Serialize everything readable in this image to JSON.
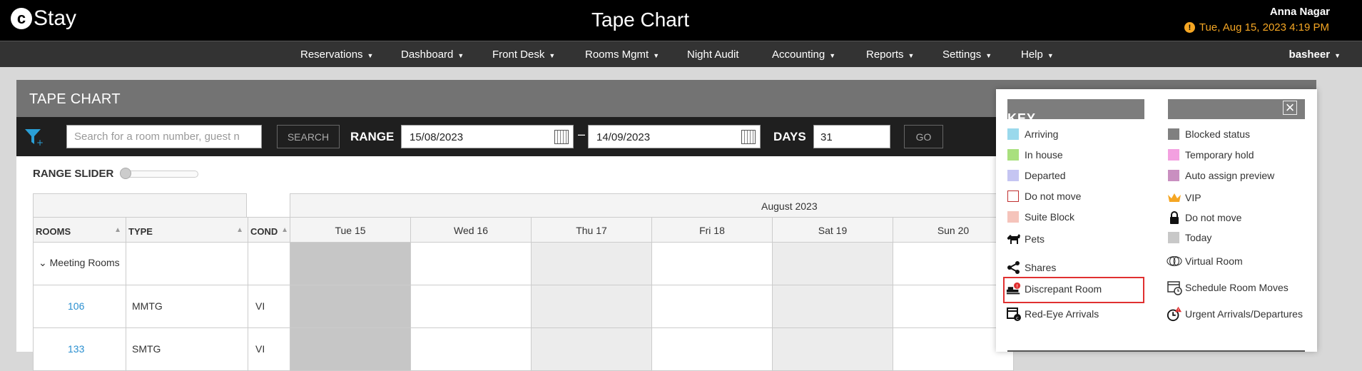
{
  "topbar": {
    "logo_letter": "c",
    "logo_text": "Stay",
    "title": "Tape Chart",
    "user_name": "Anna Nagar",
    "datetime": "Tue, Aug 15, 2023 4:19 PM"
  },
  "nav": {
    "items": [
      {
        "label": "Reservations"
      },
      {
        "label": "Dashboard"
      },
      {
        "label": "Front Desk"
      },
      {
        "label": "Rooms Mgmt"
      },
      {
        "label": "Night Audit"
      },
      {
        "label": "Accounting"
      },
      {
        "label": "Reports"
      },
      {
        "label": "Settings"
      },
      {
        "label": "Help"
      }
    ],
    "user": "basheer"
  },
  "panel": {
    "title": "TAPE CHART",
    "search_placeholder": "Search for a room number, guest n",
    "search_button": "SEARCH",
    "range_label": "RANGE",
    "range_start": "15/08/2023",
    "range_sep": "–",
    "range_end": "14/09/2023",
    "days_label": "DAYS",
    "days_value": "31",
    "go_button": "GO",
    "slider_label": "RANGE SLIDER"
  },
  "grid": {
    "month": "August 2023",
    "columns": {
      "rooms": "ROOMS",
      "type": "TYPE",
      "cond": "COND"
    },
    "days": [
      "Tue 15",
      "Wed 16",
      "Thu 17",
      "Fri 18",
      "Sat 19",
      "Sun 20"
    ],
    "group": "Meeting Rooms",
    "rows": [
      {
        "room": "106",
        "type": "MMTG",
        "cond": "VI"
      },
      {
        "room": "133",
        "type": "SMTG",
        "cond": "VI"
      }
    ]
  },
  "key": {
    "title": "KEY",
    "left": [
      {
        "label": "Arriving",
        "color": "#9ad9ec"
      },
      {
        "label": "In house",
        "color": "#a9e07e"
      },
      {
        "label": "Departed",
        "color": "#c5c5f2"
      },
      {
        "label": "Do not move",
        "color": "#ffffff",
        "border": "#c03030"
      },
      {
        "label": "Suite Block",
        "color": "#f5c4bb"
      },
      {
        "label": "Pets",
        "icon": "dog-icon"
      },
      {
        "label": "Shares",
        "icon": "share-icon"
      },
      {
        "label": "Discrepant Room",
        "icon": "discrepant-room-icon"
      },
      {
        "label": "Red-Eye Arrivals",
        "icon": "red-eye-calendar-icon"
      }
    ],
    "right": [
      {
        "label": "Blocked status",
        "color": "#808080"
      },
      {
        "label": "Temporary hold",
        "color": "#f3a0e0"
      },
      {
        "label": "Auto assign preview",
        "color": "#c98fc0"
      },
      {
        "label": "VIP",
        "icon": "crown-icon"
      },
      {
        "label": "Do not move",
        "icon": "lock-icon"
      },
      {
        "label": "Today",
        "color": "#c8c8c8"
      },
      {
        "label": "Virtual Room",
        "icon": "virtual-room-icon"
      },
      {
        "label": "Schedule Room Moves",
        "icon": "schedule-moves-icon"
      },
      {
        "label": "Urgent Arrivals/Departures",
        "icon": "urgent-clock-icon"
      }
    ]
  }
}
